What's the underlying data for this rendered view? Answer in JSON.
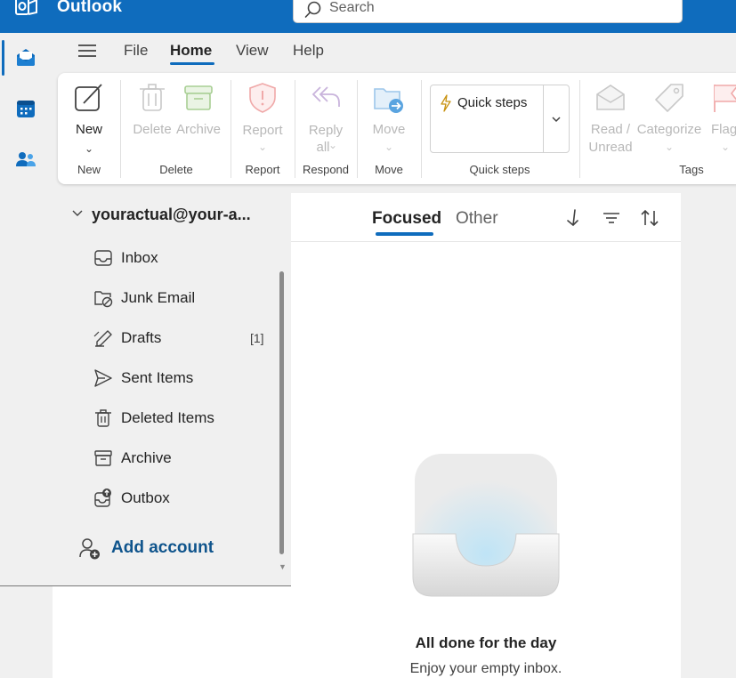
{
  "app": {
    "title": "Outlook"
  },
  "search": {
    "placeholder": "Search"
  },
  "menu": {
    "items": [
      {
        "label": "File",
        "active": false
      },
      {
        "label": "Home",
        "active": true
      },
      {
        "label": "View",
        "active": false
      },
      {
        "label": "Help",
        "active": false
      }
    ]
  },
  "ribbon": {
    "new": {
      "label": "New",
      "group": "New"
    },
    "delete": {
      "label": "Delete",
      "group": "Delete"
    },
    "archive": {
      "label": "Archive"
    },
    "report": {
      "label": "Report",
      "group": "Report"
    },
    "reply_all": {
      "line1": "Reply",
      "line2": "all",
      "group": "Respond"
    },
    "move": {
      "label": "Move",
      "group": "Move"
    },
    "quick_steps": {
      "label": "Quick steps",
      "group": "Quick steps"
    },
    "read_unread": {
      "line1": "Read /",
      "line2": "Unread"
    },
    "categorize": {
      "label": "Categorize"
    },
    "flag": {
      "label": "Flag"
    },
    "tags_group": "Tags"
  },
  "folders": {
    "account": "youractual@your-a...",
    "items": [
      {
        "label": "Inbox",
        "icon": "inbox-icon",
        "count": ""
      },
      {
        "label": "Junk Email",
        "icon": "junk-icon",
        "count": ""
      },
      {
        "label": "Drafts",
        "icon": "drafts-icon",
        "count": "[1]"
      },
      {
        "label": "Sent Items",
        "icon": "send-icon",
        "count": ""
      },
      {
        "label": "Deleted Items",
        "icon": "trash-icon",
        "count": ""
      },
      {
        "label": "Archive",
        "icon": "archive-icon",
        "count": ""
      },
      {
        "label": "Outbox",
        "icon": "outbox-icon",
        "count": ""
      }
    ],
    "add_account": "Add account"
  },
  "message_list": {
    "tabs": [
      {
        "label": "Focused",
        "selected": true
      },
      {
        "label": "Other",
        "selected": false
      }
    ],
    "empty_title": "All done for the day",
    "empty_subtitle": "Enjoy your empty inbox."
  },
  "colors": {
    "brand": "#0f6cbd",
    "link": "#0f548c"
  }
}
